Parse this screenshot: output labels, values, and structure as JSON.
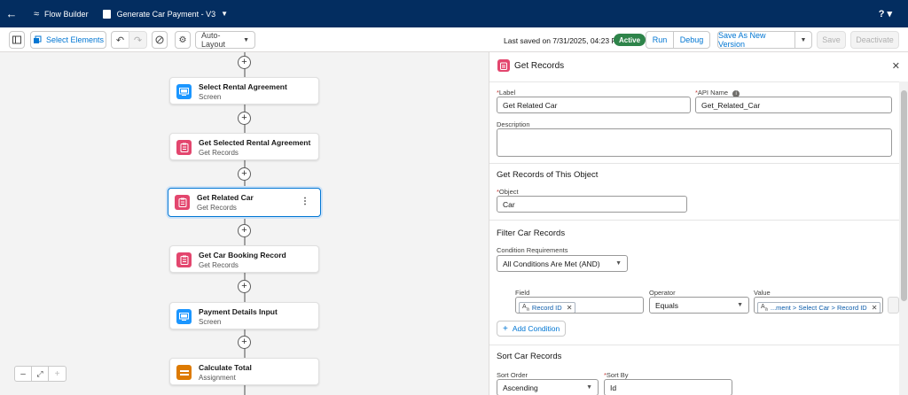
{
  "header": {
    "app_name": "Flow Builder",
    "flow_name": "Generate Car Payment - V3",
    "help_label": "?"
  },
  "toolbar": {
    "select_elements_label": "Select Elements",
    "layout_option": "Auto-Layout",
    "saved_status": "Last saved on 7/31/2025, 04:23 PM",
    "active_badge": "Active",
    "run_label": "Run",
    "debug_label": "Debug",
    "save_new_version_label": "Save As New Version",
    "save_label": "Save",
    "deactivate_label": "Deactivate"
  },
  "canvas": {
    "nodes": [
      {
        "title": "Select Rental Agreement",
        "subtitle": "Screen",
        "icon": "screen-icon"
      },
      {
        "title": "Get Selected Rental Agreement",
        "subtitle": "Get Records",
        "icon": "get-records-icon"
      },
      {
        "title": "Get Related Car",
        "subtitle": "Get Records",
        "icon": "get-records-icon"
      },
      {
        "title": "Get Car Booking Record",
        "subtitle": "Get Records",
        "icon": "get-records-icon"
      },
      {
        "title": "Payment Details Input",
        "subtitle": "Screen",
        "icon": "screen-icon"
      },
      {
        "title": "Calculate Total",
        "subtitle": "Assignment",
        "icon": "assignment-icon"
      }
    ]
  },
  "panel": {
    "title": "Get Records",
    "label_caption": "Label",
    "label_value": "Get Related Car",
    "api_caption": "API Name",
    "api_value": "Get_Related_Car",
    "description_caption": "Description",
    "object_section": "Get Records of This Object",
    "object_caption": "Object",
    "object_value": "Car",
    "filter_section": "Filter Car Records",
    "condition_caption": "Condition Requirements",
    "condition_value": "All Conditions Are Met (AND)",
    "field_caption": "Field",
    "field_value": "Record ID",
    "operator_caption": "Operator",
    "operator_value": "Equals",
    "value_caption": "Value",
    "value_value": "...ment > Select Car > Record ID",
    "add_condition_label": "Add Condition",
    "sort_section": "Sort Car Records",
    "sort_order_caption": "Sort Order",
    "sort_order_value": "Ascending",
    "sort_by_caption": "Sort By",
    "sort_by_value": "Id"
  },
  "colors": {
    "header_bg": "#032d60",
    "accent": "#0176d3",
    "active_green": "#2e844a",
    "get_records_pink": "#e3466e",
    "screen_blue": "#1b96ff",
    "assignment_orange": "#dd7a01"
  }
}
